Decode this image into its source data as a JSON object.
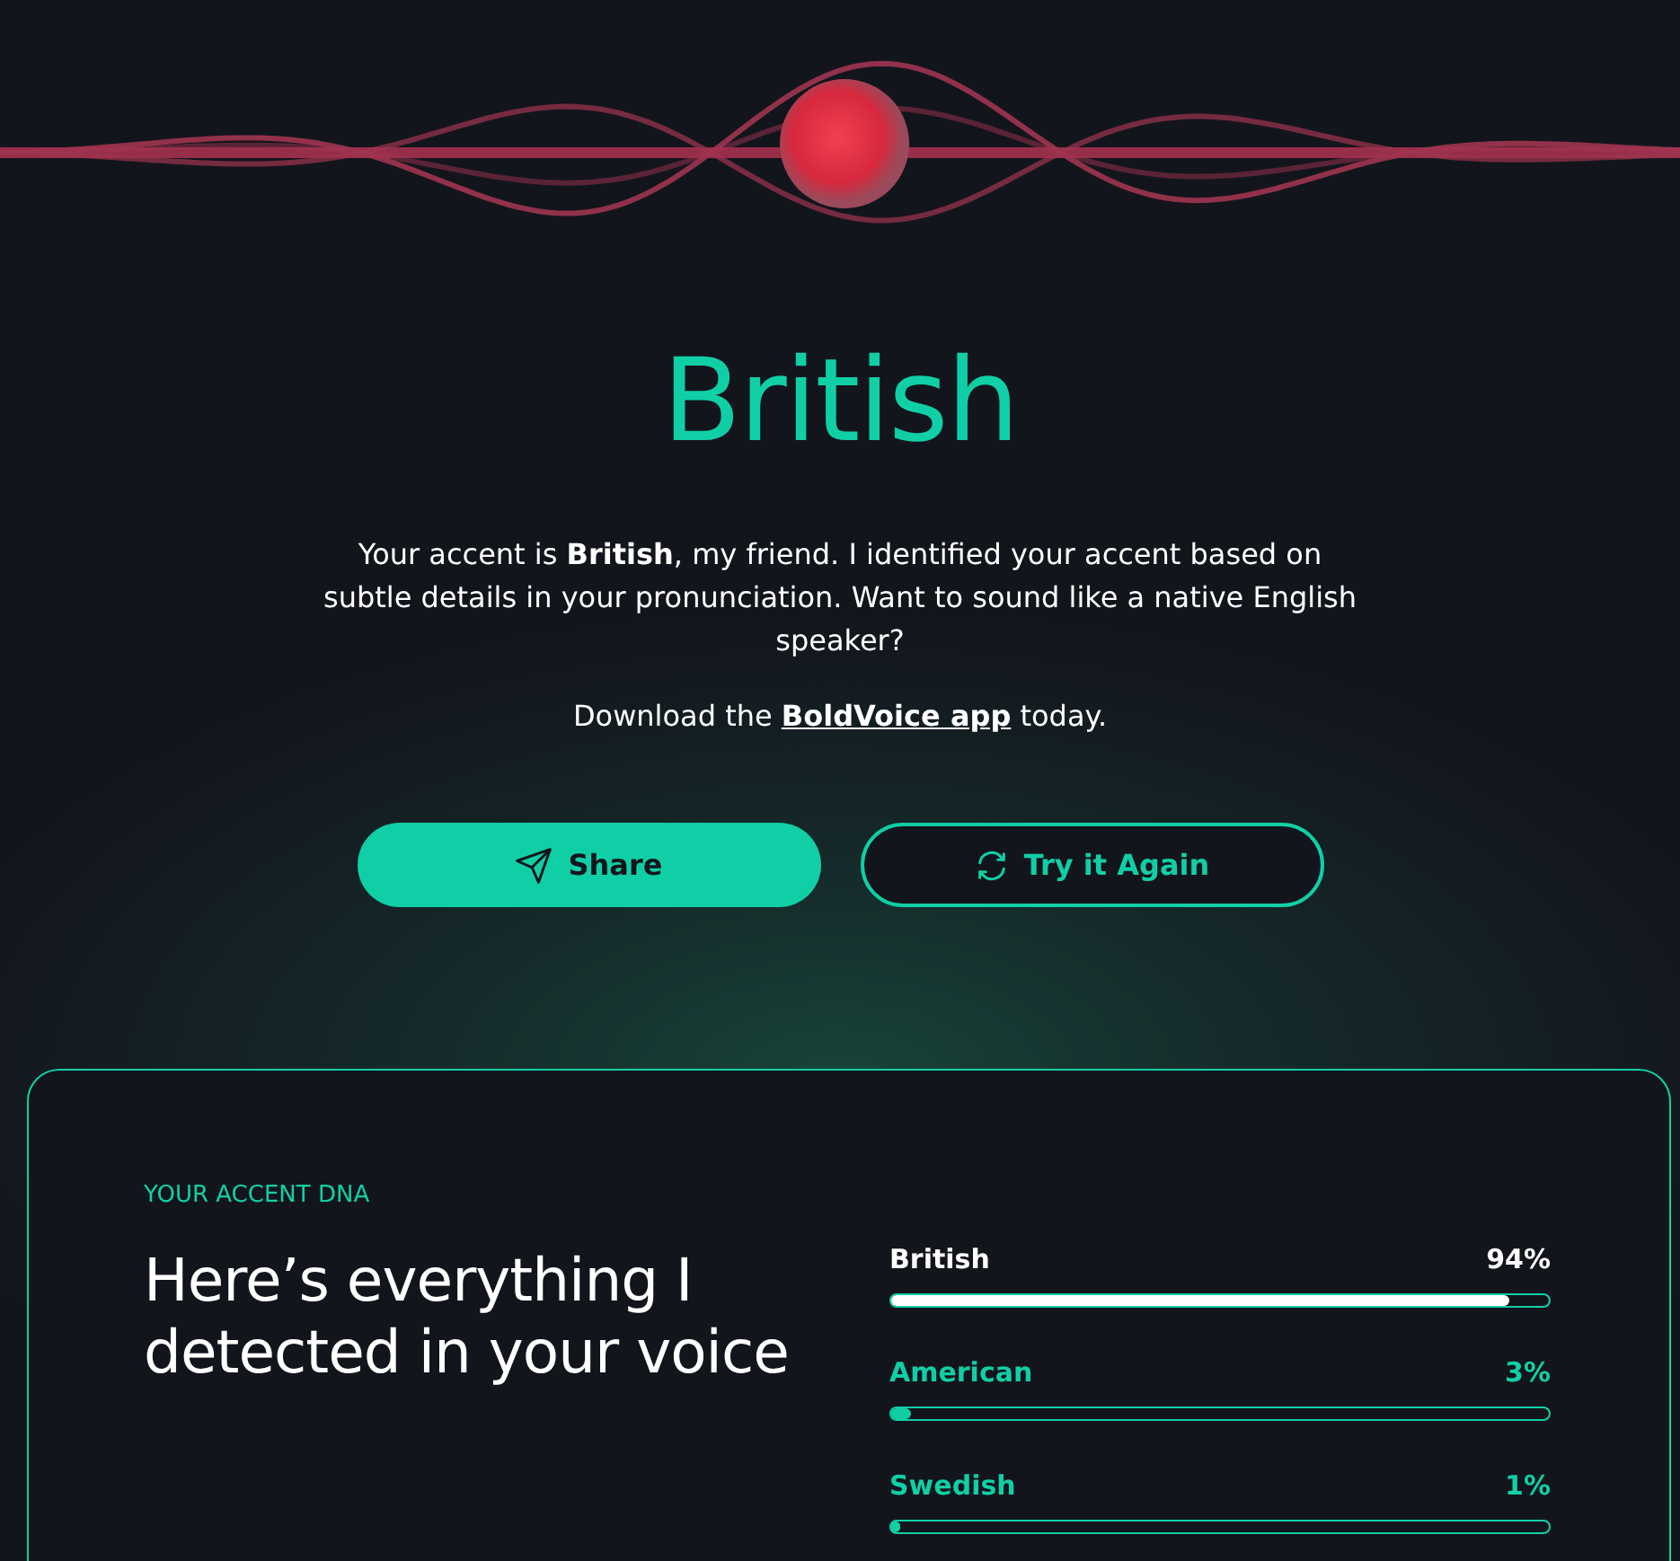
{
  "result": {
    "accent": "British",
    "message": "Your accent is **British**, my friend. I identified your accent based on subtle details in your pronunciation. Want to sound like a native English speaker?",
    "download_prefix": "Download the ",
    "download_link": "BoldVoice app",
    "download_suffix": " today."
  },
  "buttons": [
    {
      "kind": "share",
      "label": "Share"
    },
    {
      "kind": "retry",
      "label": "Try it Again"
    }
  ],
  "dna": {
    "eyebrow": "YOUR ACCENT DNA",
    "heading": "Here’s everything I detected in your voice",
    "accents": [
      {
        "name": "British",
        "reading": "94%",
        "level": 0.94,
        "selected": true
      },
      {
        "name": "American",
        "reading": "3%",
        "level": 0.03,
        "selected": false
      },
      {
        "name": "Swedish",
        "reading": "1%",
        "level": 0.01,
        "selected": false
      }
    ]
  }
}
